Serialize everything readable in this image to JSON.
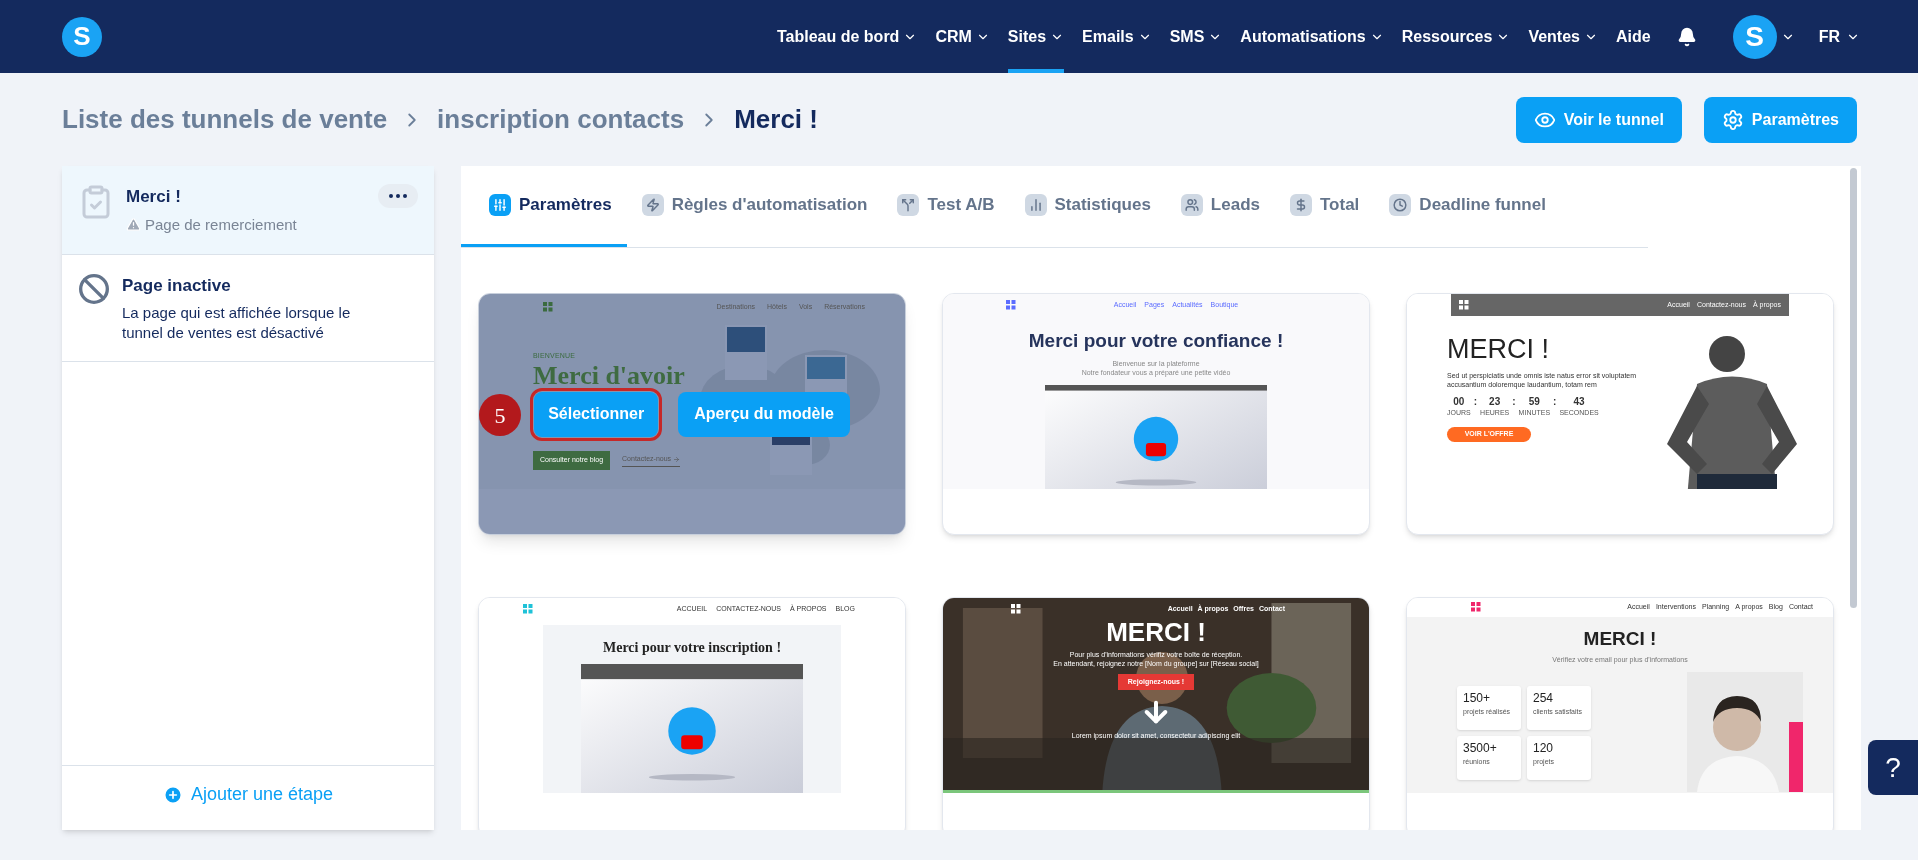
{
  "nav": {
    "logo": "S",
    "items": [
      {
        "label": "Tableau de bord",
        "dropdown": true,
        "selected": false
      },
      {
        "label": "CRM",
        "dropdown": true,
        "selected": false
      },
      {
        "label": "Sites",
        "dropdown": true,
        "selected": true
      },
      {
        "label": "Emails",
        "dropdown": true,
        "selected": false
      },
      {
        "label": "SMS",
        "dropdown": true,
        "selected": false
      },
      {
        "label": "Automatisations",
        "dropdown": true,
        "selected": false
      },
      {
        "label": "Ressources",
        "dropdown": true,
        "selected": false
      },
      {
        "label": "Ventes",
        "dropdown": true,
        "selected": false
      },
      {
        "label": "Aide",
        "dropdown": false,
        "selected": false
      }
    ],
    "avatar": "S",
    "language": "FR"
  },
  "breadcrumb": [
    "Liste des tunnels de vente",
    "inscription contacts",
    "Merci !"
  ],
  "header_buttons": [
    "Voir le tunnel",
    "Paramètres"
  ],
  "sidebar": {
    "steps": [
      {
        "kind": "page",
        "title": "Merci !",
        "subtitle": "Page de remerciement",
        "selected": true
      },
      {
        "kind": "inactive",
        "title": "Page inactive",
        "description": "La page qui est affichée lorsque le tunnel de ventes est désactivé",
        "selected": false
      }
    ],
    "add_step": "Ajouter une étape"
  },
  "tabs": [
    {
      "label": "Paramètres",
      "selected": true
    },
    {
      "label": "Règles d'automatisation",
      "selected": false
    },
    {
      "label": "Test A/B",
      "selected": false
    },
    {
      "label": "Statistiques",
      "selected": false
    },
    {
      "label": "Leads",
      "selected": false
    },
    {
      "label": "Total",
      "selected": false
    },
    {
      "label": "Deadline funnel",
      "selected": false
    }
  ],
  "overlay": {
    "select_label": "Sélectionner",
    "preview_label": "Aperçu du modèle",
    "select_highlighted": true,
    "step_number": "5"
  },
  "templates": [
    {
      "kind": "travel",
      "hovered": true,
      "nav": [
        "Destinations",
        "Hôtels",
        "Vols",
        "Réservations"
      ],
      "eyebrow": "BIENVENUE",
      "heading": "Merci d'avoir",
      "buttons": [
        "Consulter notre blog",
        "Contactez-nous"
      ]
    },
    {
      "kind": "video",
      "hovered": false,
      "nav": [
        "Accueil",
        "Pages",
        "Actualités",
        "Boutique"
      ],
      "heading": "Merci pour votre confiance !",
      "lines": [
        "Bienvenue sur la plateforme",
        "Notre fondateur vous a préparé une petite vidéo"
      ]
    },
    {
      "kind": "countdown",
      "hovered": false,
      "nav": [
        "Accueil",
        "Contactez-nous",
        "À propos"
      ],
      "heading": "MERCI !",
      "text": "Sed ut perspiciatis unde omnis iste natus error sit voluptatem accusantium doloremque laudantium, totam rem",
      "separator": ":",
      "countdown": [
        {
          "value": "00",
          "label": "JOURS"
        },
        {
          "value": "23",
          "label": "HEURES"
        },
        {
          "value": "59",
          "label": "MINUTES"
        },
        {
          "value": "43",
          "label": "SECONDES"
        }
      ],
      "button": "VOIR L'OFFRE"
    },
    {
      "kind": "video_boxed",
      "hovered": false,
      "nav": [
        "ACCUEIL",
        "CONTACTEZ-NOUS",
        "À PROPOS",
        "BLOG"
      ],
      "heading": "Merci pour votre inscription !"
    },
    {
      "hovered": false,
      "nav": [
        "Accueil",
        "À propos",
        "Offres",
        "Contact"
      ],
      "heading": "MERCI !",
      "lines": [
        "Pour plus d'informations vérifiz votre boîte de réception.",
        "En attendant, rejoignez notre [Nom du groupe] sur [Réseau social]"
      ],
      "button": "Rejoignez-nous !",
      "footer": "Lorem ipsum dolor sit amet, consectetur adipiscing elit"
    },
    {
      "kind": "stats",
      "hovered": false,
      "nav": [
        "Accueil",
        "Interventions",
        "Planning",
        "A propos",
        "Blog",
        "Contact"
      ],
      "heading": "MERCI !",
      "subtitle": "Vérifiez votre email pour plus d'informations",
      "stats": [
        {
          "value": "150+",
          "label": "projets réalisés"
        },
        {
          "value": "254",
          "label": "clients satisfaits"
        },
        {
          "value": "3500+",
          "label": "réunions"
        },
        {
          "value": "120",
          "label": "projets"
        }
      ]
    }
  ],
  "help": "?"
}
